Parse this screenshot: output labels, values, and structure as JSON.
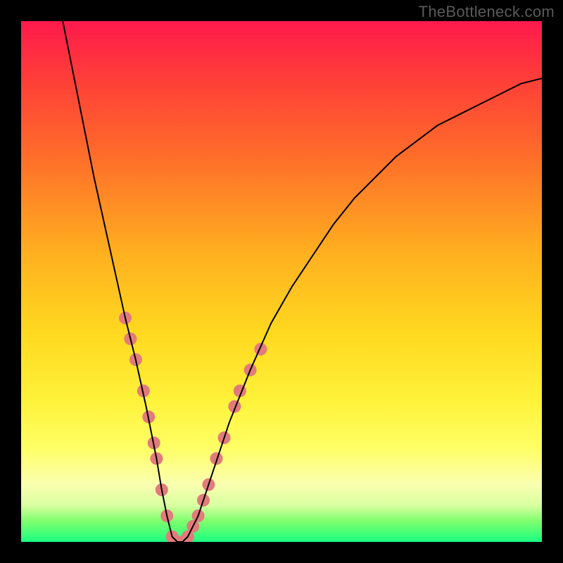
{
  "watermark": "TheBottleneck.com",
  "chart_data": {
    "type": "line",
    "title": "",
    "xlabel": "",
    "ylabel": "",
    "xlim": [
      0,
      100
    ],
    "ylim": [
      0,
      100
    ],
    "grid": false,
    "legend": false,
    "background_gradient": {
      "direction": "vertical",
      "stops": [
        {
          "pos": 0.0,
          "color": "#ff1a4d"
        },
        {
          "pos": 0.1,
          "color": "#ff3a3a"
        },
        {
          "pos": 0.25,
          "color": "#ff6a2a"
        },
        {
          "pos": 0.45,
          "color": "#ffb11f"
        },
        {
          "pos": 0.6,
          "color": "#ffd91f"
        },
        {
          "pos": 0.73,
          "color": "#fff23a"
        },
        {
          "pos": 0.82,
          "color": "#ffff66"
        },
        {
          "pos": 0.89,
          "color": "#faffb0"
        },
        {
          "pos": 0.93,
          "color": "#d8ffa0"
        },
        {
          "pos": 0.96,
          "color": "#7fff6e"
        },
        {
          "pos": 1.0,
          "color": "#1aff80"
        }
      ]
    },
    "series": [
      {
        "name": "bottleneck-curve",
        "color": "#000000",
        "stroke_width": 2,
        "x": [
          8,
          10,
          12,
          14,
          16,
          18,
          20,
          22,
          24,
          26,
          27,
          28,
          29,
          30,
          31,
          32,
          34,
          36,
          38,
          40,
          44,
          48,
          52,
          56,
          60,
          64,
          68,
          72,
          76,
          80,
          84,
          88,
          92,
          96,
          100
        ],
        "y": [
          100,
          90,
          80,
          70,
          61,
          52,
          43,
          35,
          26,
          16,
          10,
          5,
          1,
          0,
          0,
          1,
          5,
          11,
          17,
          23,
          33,
          42,
          49,
          55,
          61,
          66,
          70,
          74,
          77,
          80,
          82,
          84,
          86,
          88,
          89
        ]
      }
    ],
    "markers": {
      "name": "highlight-dots",
      "color": "#e27b7b",
      "radius": 9,
      "points": [
        {
          "x": 20.0,
          "y": 43
        },
        {
          "x": 21.0,
          "y": 39
        },
        {
          "x": 22.0,
          "y": 35
        },
        {
          "x": 23.5,
          "y": 29
        },
        {
          "x": 24.5,
          "y": 24
        },
        {
          "x": 25.5,
          "y": 19
        },
        {
          "x": 26.0,
          "y": 16
        },
        {
          "x": 27.0,
          "y": 10
        },
        {
          "x": 28.0,
          "y": 5
        },
        {
          "x": 29.0,
          "y": 1
        },
        {
          "x": 30.0,
          "y": 0
        },
        {
          "x": 31.0,
          "y": 0
        },
        {
          "x": 32.0,
          "y": 1
        },
        {
          "x": 33.0,
          "y": 3
        },
        {
          "x": 34.0,
          "y": 5
        },
        {
          "x": 35.0,
          "y": 8
        },
        {
          "x": 36.0,
          "y": 11
        },
        {
          "x": 37.5,
          "y": 16
        },
        {
          "x": 39.0,
          "y": 20
        },
        {
          "x": 41.0,
          "y": 26
        },
        {
          "x": 42.0,
          "y": 29
        },
        {
          "x": 44.0,
          "y": 33
        },
        {
          "x": 46.0,
          "y": 37
        }
      ]
    }
  }
}
